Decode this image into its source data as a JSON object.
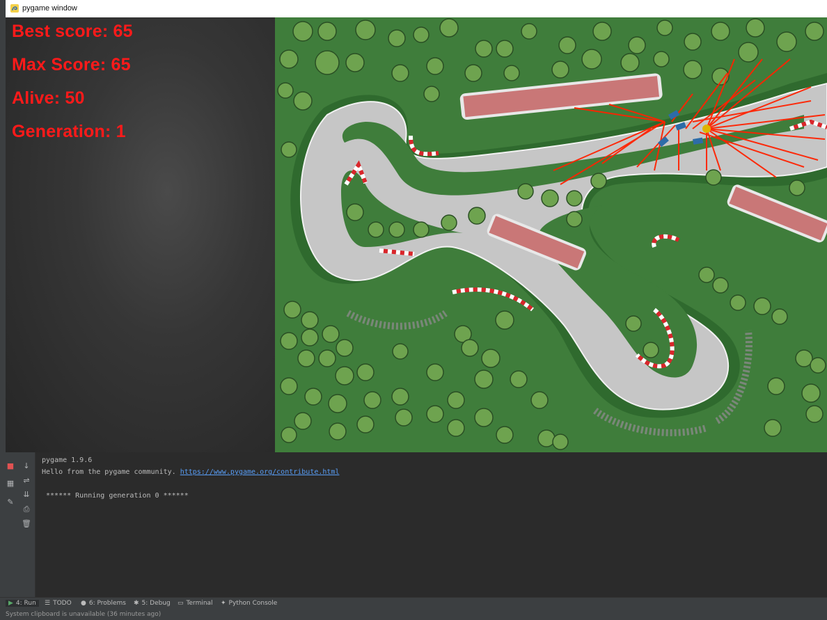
{
  "window": {
    "title": "pygame window"
  },
  "stats": {
    "best_score": "Best score: 65",
    "max_score": "Max Score: 65",
    "alive": "Alive: 50",
    "generation": "Generation: 1"
  },
  "colors": {
    "stat_text": "#ff1a1a",
    "grass": "#3d7c3a",
    "track": "#c4c4c4",
    "sensor": "#ff2200"
  },
  "console": {
    "lines": [
      "pygame 1.9.6",
      "Hello from the pygame community. ",
      "",
      " ****** Running generation 0 ******"
    ],
    "link": "https://www.pygame.org/contribute.html"
  },
  "gutter_icons": [
    "stop-icon",
    "down-arrow-icon",
    "layout-icon",
    "soft-wrap-icon",
    "pin-icon",
    "scroll-to-end-icon",
    "print-icon",
    "trash-icon"
  ],
  "tool_tabs": [
    {
      "label": "4: Run",
      "icon": "play-icon"
    },
    {
      "label": "TODO",
      "icon": "list-icon"
    },
    {
      "label": "6: Problems",
      "icon": "info-icon"
    },
    {
      "label": "5: Debug",
      "icon": "bug-icon"
    },
    {
      "label": "Terminal",
      "icon": "terminal-icon"
    },
    {
      "label": "Python Console",
      "icon": "python-icon"
    }
  ],
  "status": "System clipboard is unavailable (36 minutes ago)"
}
